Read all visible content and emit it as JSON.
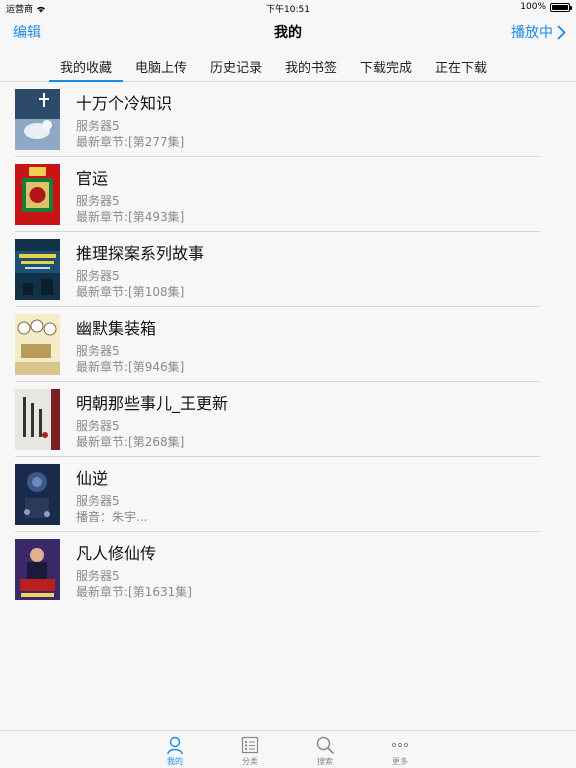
{
  "status": {
    "carrier": "运营商",
    "time": "下午10:51",
    "battery": "100%"
  },
  "nav": {
    "left": "编辑",
    "title": "我的",
    "right": "播放中"
  },
  "tabs": [
    {
      "label": "我的收藏",
      "active": true
    },
    {
      "label": "电脑上传",
      "active": false
    },
    {
      "label": "历史记录",
      "active": false
    },
    {
      "label": "我的书签",
      "active": false
    },
    {
      "label": "下载完成",
      "active": false
    },
    {
      "label": "正在下载",
      "active": false
    }
  ],
  "books": [
    {
      "title": "十万个冷知识",
      "server": "服务器5",
      "chapter": "最新章节:[第277集]"
    },
    {
      "title": "官运",
      "server": "服务器5",
      "chapter": "最新章节:[第493集]"
    },
    {
      "title": "推理探案系列故事",
      "server": "服务器5",
      "chapter": "最新章节:[第108集]"
    },
    {
      "title": "幽默集装箱",
      "server": "服务器5",
      "chapter": "最新章节:[第946集]"
    },
    {
      "title": "明朝那些事儿_王更新",
      "server": "服务器5",
      "chapter": "最新章节:[第268集]"
    },
    {
      "title": "仙逆",
      "server": "服务器5",
      "chapter": "播音：朱宇..."
    },
    {
      "title": "凡人修仙传",
      "server": "服务器5",
      "chapter": "最新章节:[第1631集]"
    }
  ],
  "tabbar": [
    {
      "label": "我的",
      "icon": "person-icon",
      "active": true
    },
    {
      "label": "分类",
      "icon": "list-icon",
      "active": false
    },
    {
      "label": "搜索",
      "icon": "search-icon",
      "active": false
    },
    {
      "label": "更多",
      "icon": "more-icon",
      "active": false
    }
  ],
  "colors": {
    "accent": "#1a8be8"
  }
}
